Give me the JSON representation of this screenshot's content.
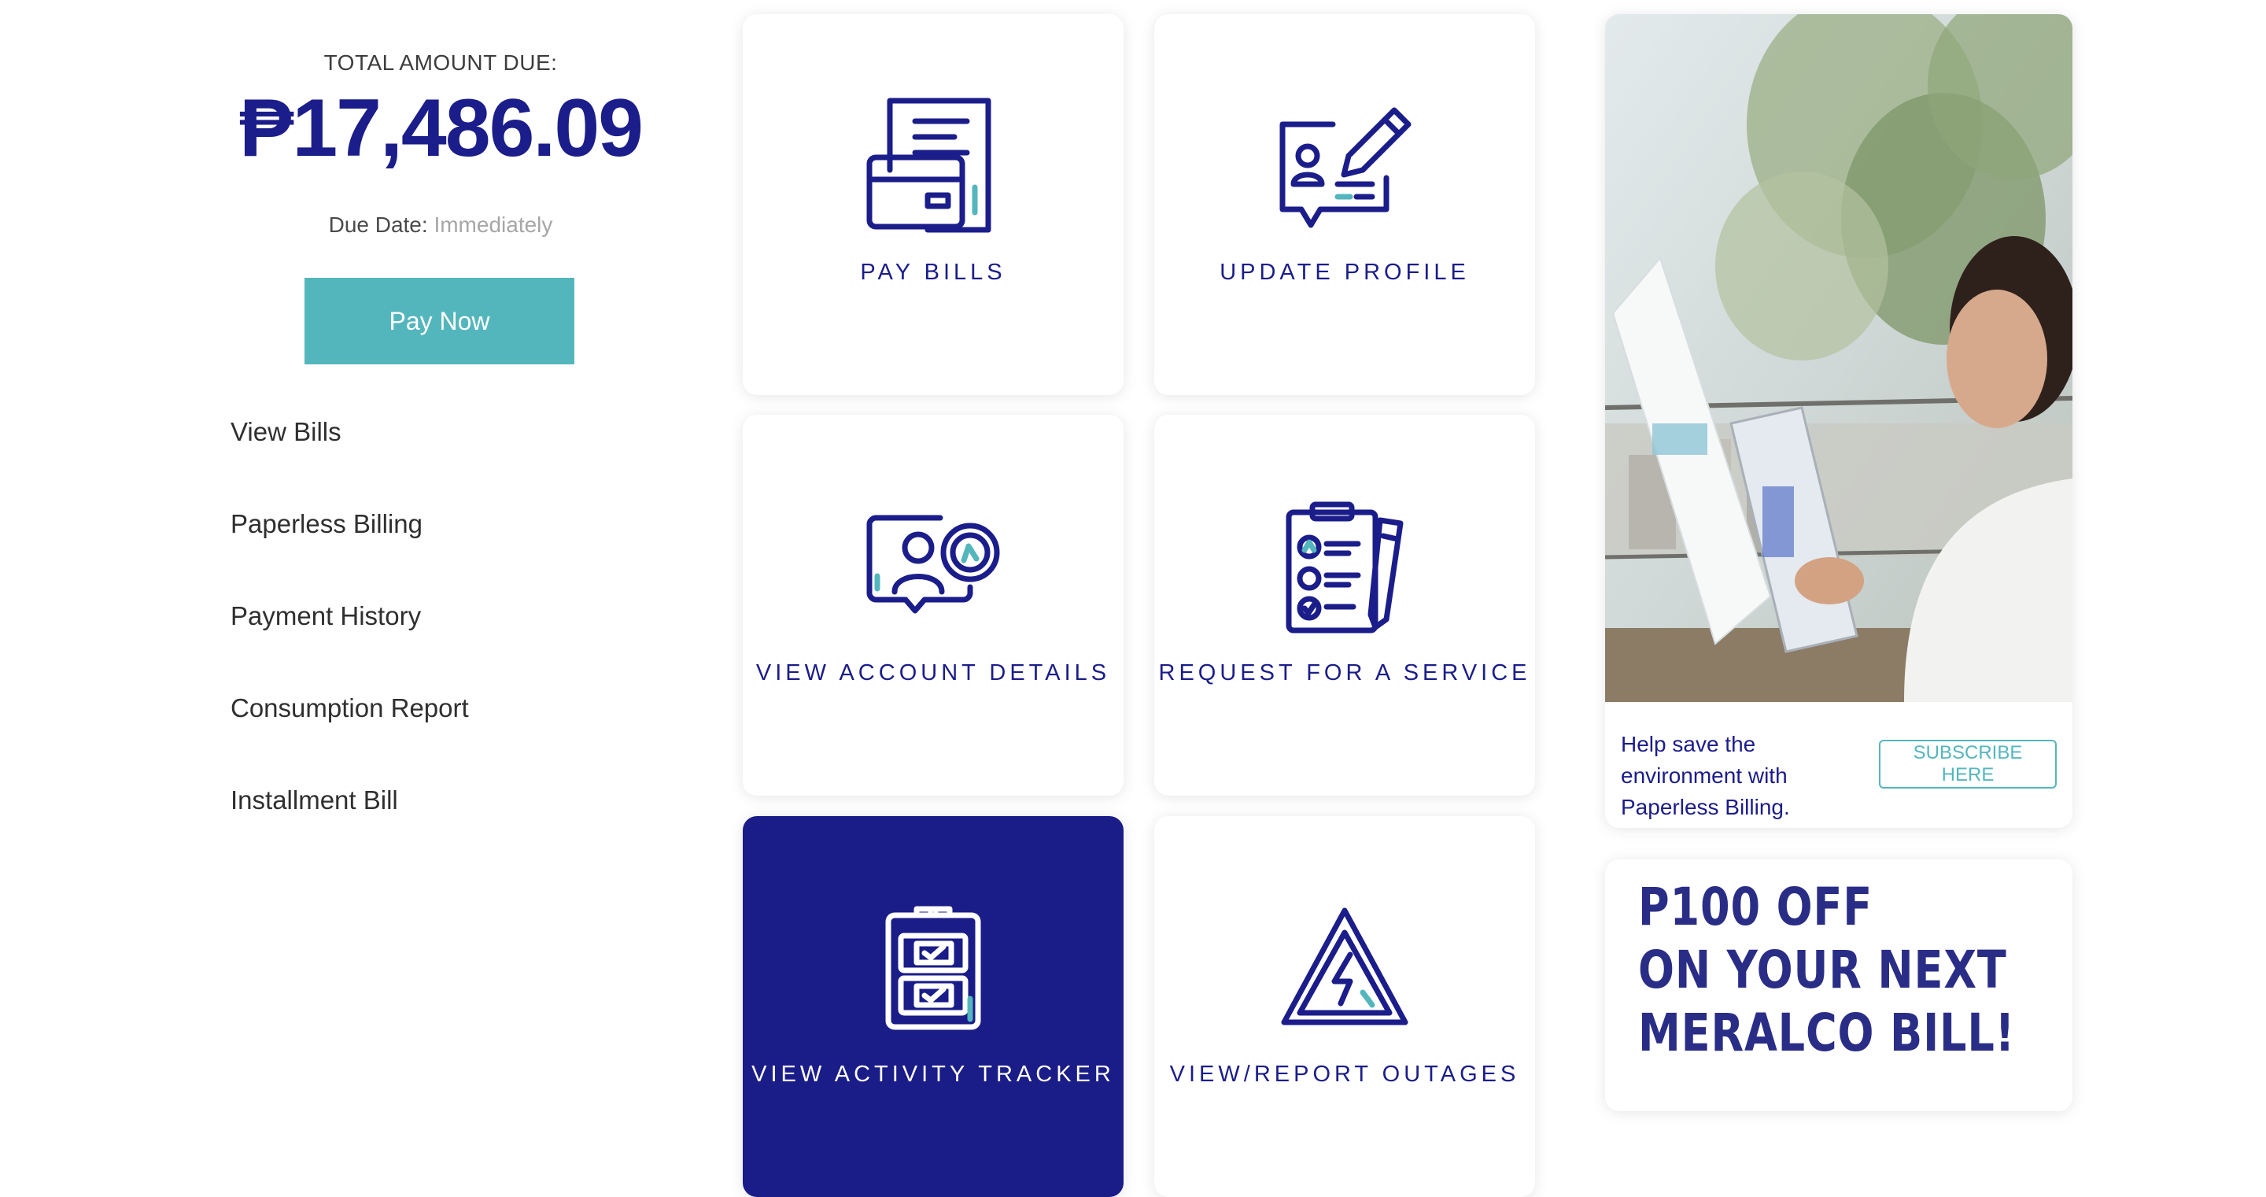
{
  "summary": {
    "total_label": "TOTAL AMOUNT DUE:",
    "amount": "₱17,486.09",
    "due_label": "Due Date:",
    "due_value": "Immediately",
    "pay_button": "Pay Now"
  },
  "menu": {
    "items": [
      "View Bills",
      "Paperless Billing",
      "Payment History",
      "Consumption Report",
      "Installment Bill"
    ]
  },
  "tiles": {
    "pay_bills": "PAY BILLS",
    "update_profile": "UPDATE PROFILE",
    "view_account_details": "VIEW ACCOUNT DETAILS",
    "request_service": "REQUEST FOR A SERVICE",
    "view_activity_tracker": "VIEW ACTIVITY TRACKER",
    "view_report_outages": "VIEW/REPORT OUTAGES"
  },
  "promo": {
    "text": "Help save the environment with Paperless Billing.",
    "button": "SUBSCRIBE HERE"
  },
  "ad": {
    "line1": "P100 OFF",
    "line2": "ON YOUR NEXT",
    "line3": "MERALCO BILL!"
  },
  "colors": {
    "brand_navy": "#1b1d8a",
    "accent_teal": "#54b6bd",
    "active_tile": "#1a1c88"
  }
}
